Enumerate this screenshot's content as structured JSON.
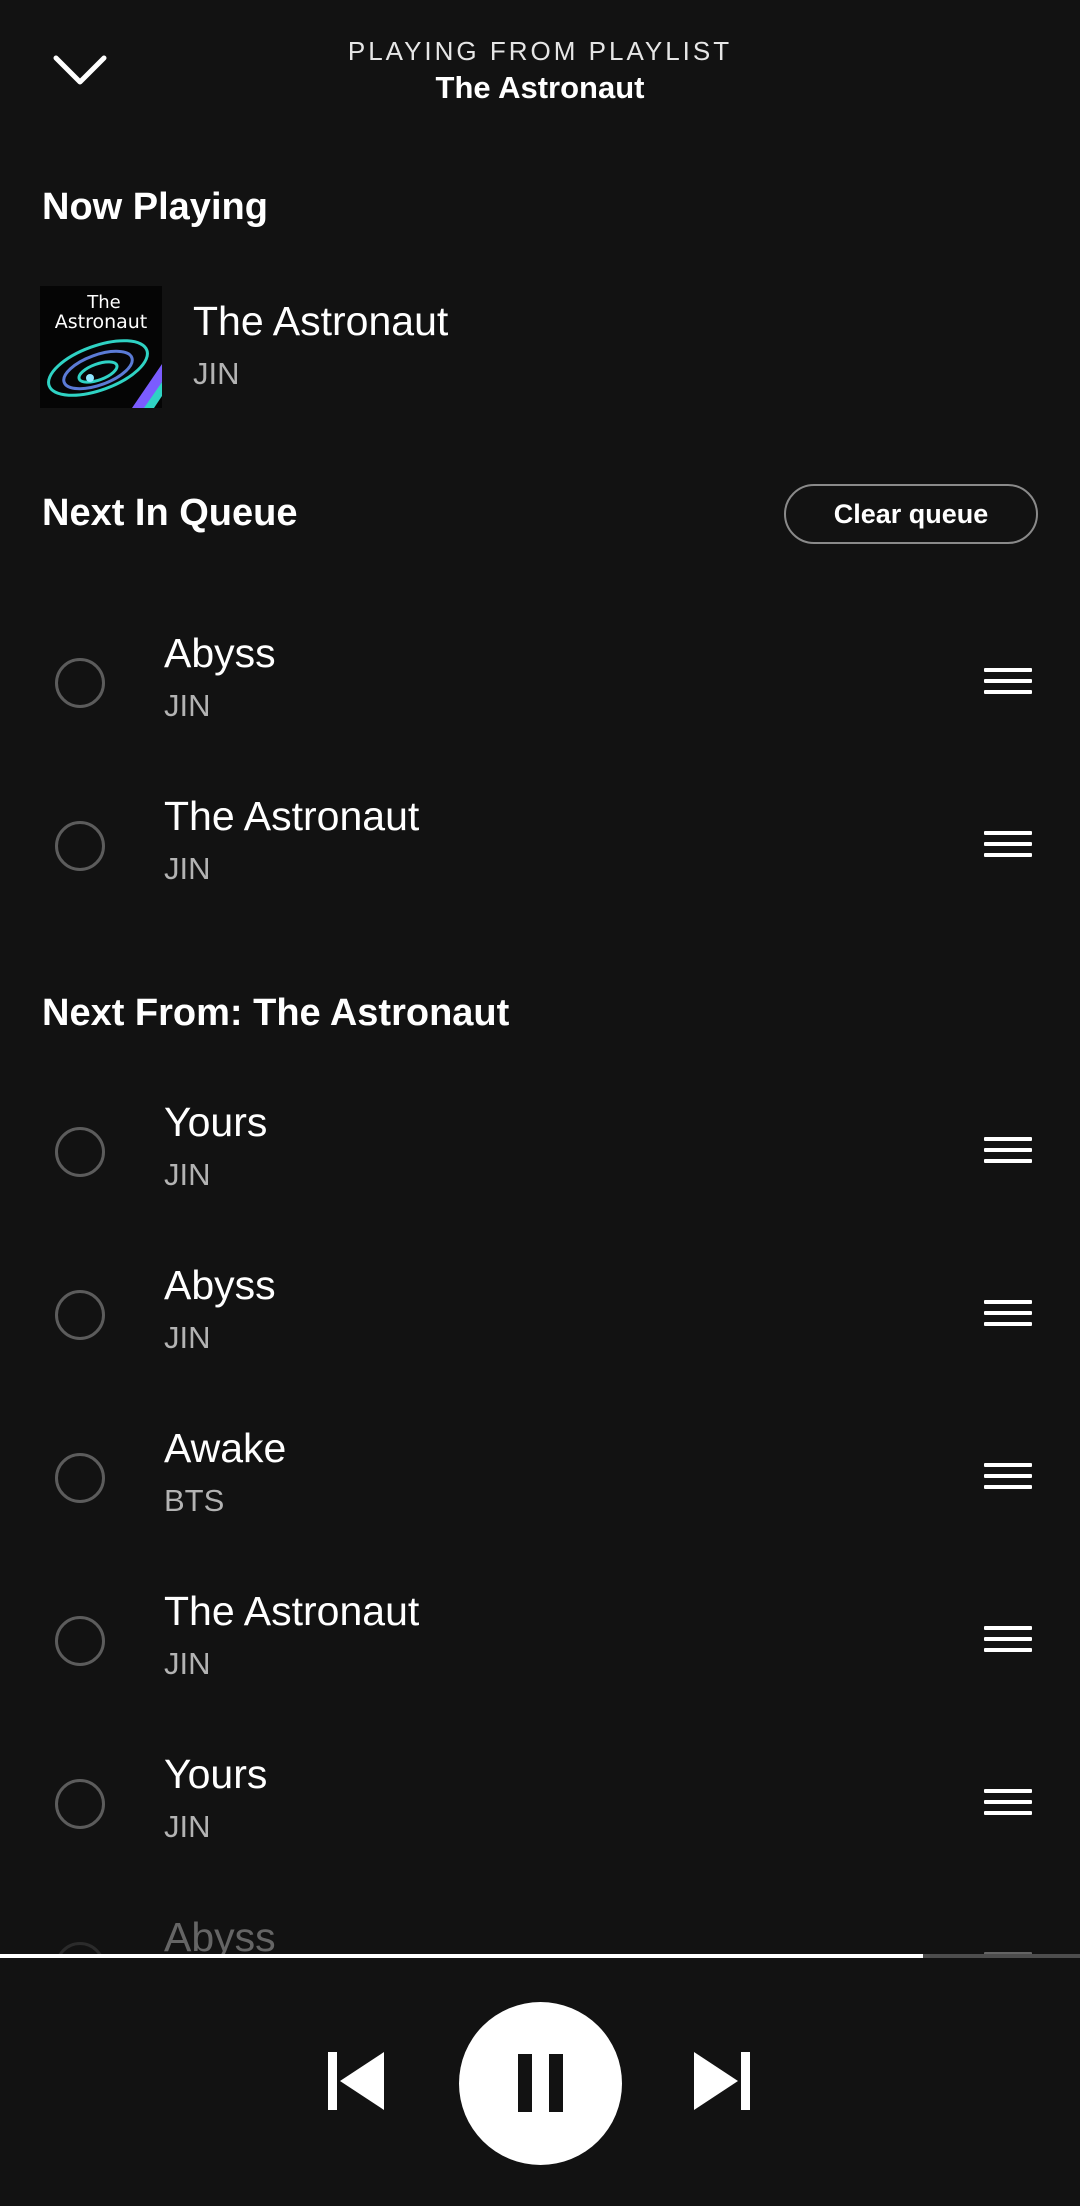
{
  "header": {
    "context_label": "PLAYING FROM PLAYLIST",
    "playlist_title": "The Astronaut"
  },
  "now_playing": {
    "section_title": "Now Playing",
    "track": {
      "title": "The Astronaut",
      "artist": "JIN",
      "art_lettering": "The Astronaut"
    }
  },
  "next_in_queue": {
    "section_title": "Next In Queue",
    "clear_label": "Clear queue",
    "tracks": [
      {
        "title": "Abyss",
        "artist": "JIN"
      },
      {
        "title": "The Astronaut",
        "artist": "JIN"
      }
    ]
  },
  "next_from": {
    "section_title": "Next From: The Astronaut",
    "tracks": [
      {
        "title": "Yours",
        "artist": "JIN"
      },
      {
        "title": "Abyss",
        "artist": "JIN"
      },
      {
        "title": "Awake",
        "artist": "BTS"
      },
      {
        "title": "The Astronaut",
        "artist": "JIN"
      },
      {
        "title": "Yours",
        "artist": "JIN"
      },
      {
        "title": "Abyss",
        "artist": ""
      }
    ]
  },
  "playback": {
    "progress_fraction": 0.855,
    "state": "playing"
  },
  "icons": {
    "collapse": "chevron-down-icon",
    "drag": "drag-handle-icon",
    "select": "radio-circle-icon",
    "previous": "skip-previous-icon",
    "pause": "pause-icon",
    "next": "skip-next-icon"
  },
  "colors": {
    "background": "#121212",
    "text_primary": "#ffffff",
    "text_secondary": "#b3b3b3",
    "progress_track": "#4d4d4d"
  }
}
